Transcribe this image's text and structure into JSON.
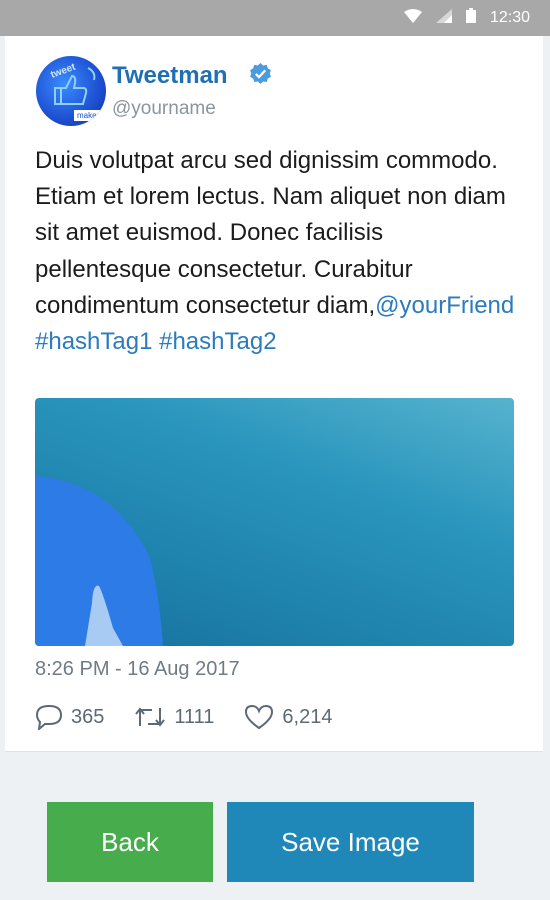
{
  "statusbar": {
    "time": "12:30",
    "icons": [
      "wifi-icon",
      "signal-icon",
      "battery-icon"
    ]
  },
  "tweet": {
    "display_name": "Tweetman",
    "handle": "@yourname",
    "verified": true,
    "avatar_text": [
      "tweet",
      "maker"
    ],
    "text_body": "Duis volutpat arcu sed dignissim commodo. Etiam et lorem lectus. Nam aliquet non diam sit amet euismod. Donec facilisis pellentesque consectetur. Curabitur condimentum consectetur diam,",
    "mention": "@yourFriend",
    "hashtags": "#hashTag1 #hashTag2",
    "timestamp": "8:26 PM - 16 Aug 2017",
    "replies": "365",
    "retweets": "1111",
    "likes": "6,214"
  },
  "actions": {
    "back_label": "Back",
    "save_label": "Save Image"
  },
  "colors": {
    "link": "#2b7bbd",
    "name": "#1f6fb5",
    "back_button": "#47ad4c",
    "save_button": "#1f88b8",
    "statusbar": "#a8a8a8"
  }
}
